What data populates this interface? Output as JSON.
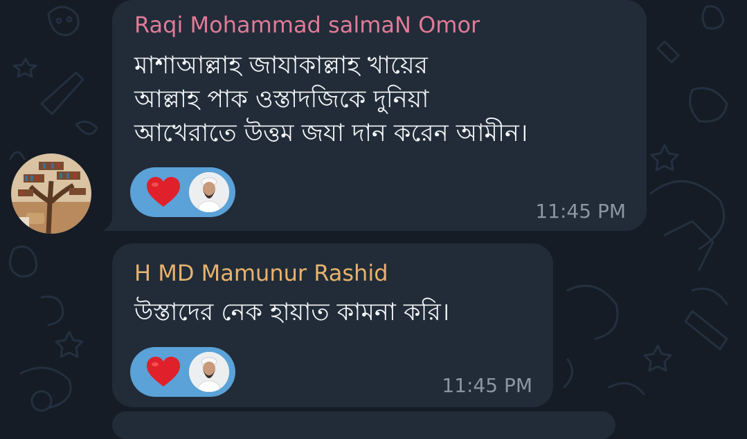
{
  "chat": {
    "messages": [
      {
        "sender": "Raqi Mohammad salmaN Omor",
        "text": "মাশাআল্লাহ জাযাকাল্লাহ খায়ের\nআল্লাহ পাক ওস্তাদজিকে  দুনিয়া\nআখেরাতে উত্তম জযা দান করেন আমীন।",
        "time": "11:45 PM",
        "reaction": "heart-reaction-icon"
      },
      {
        "sender": "H MD Mamunur Rashid",
        "text": "উস্তাদের নেক হায়াত কামনা করি।",
        "time": "11:45 PM",
        "reaction": "heart-reaction-icon"
      }
    ]
  },
  "colors": {
    "background": "#151c25",
    "bubble": "#212c38",
    "sender1": "#e07b98",
    "sender2": "#e8b26d",
    "reaction_pill": "#5aa2d8",
    "heart": "#e0202a",
    "timestamp": "#8b97a3"
  }
}
